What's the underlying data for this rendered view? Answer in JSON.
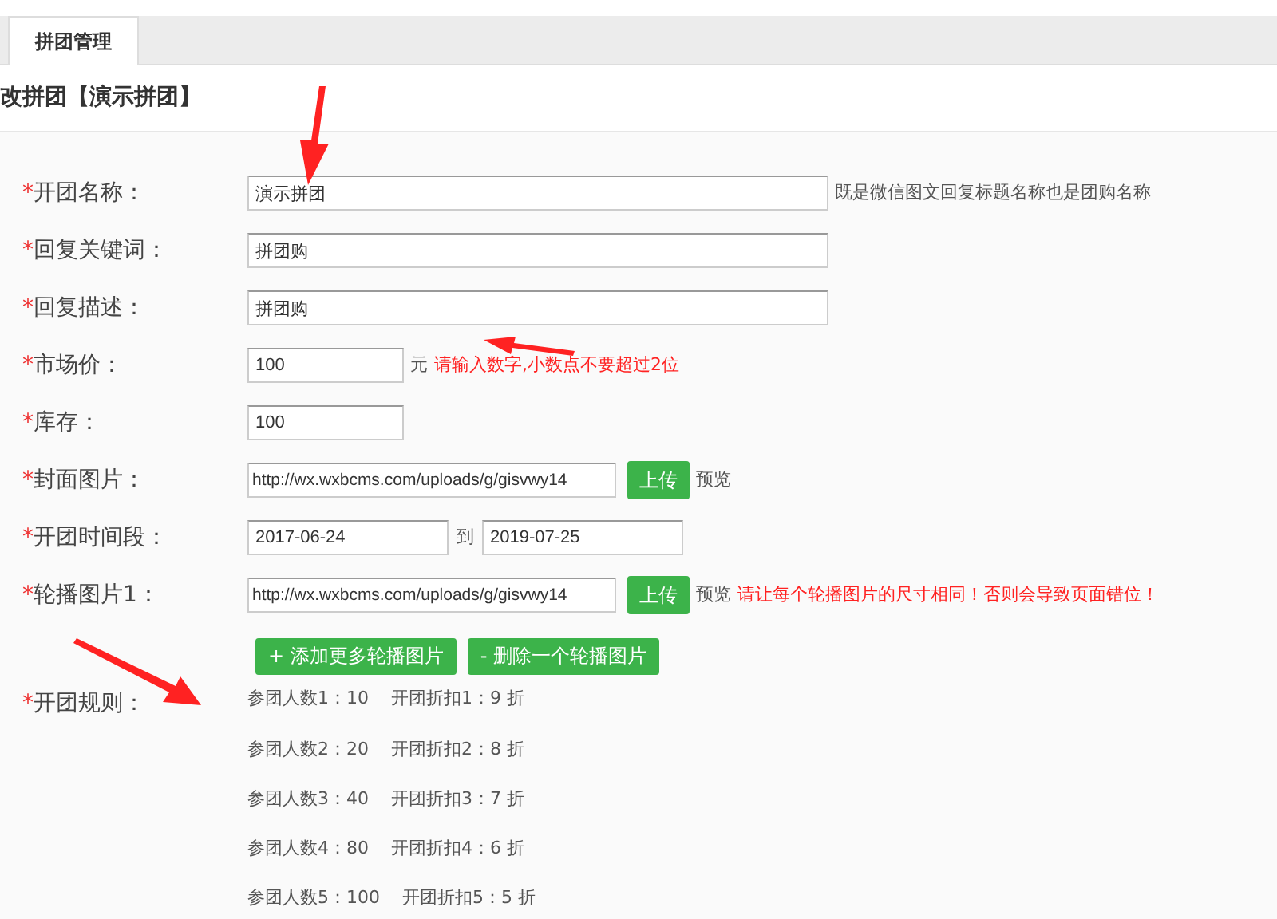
{
  "tab": {
    "label": "拼团管理",
    "selected": true
  },
  "heading": "改拼团【演示拼团】",
  "fields": [
    {
      "kind": "long",
      "mark": "*",
      "label": "开团名称：",
      "value": "演示拼团",
      "hint": "既是微信图文回复标题名称也是团购名称"
    },
    {
      "kind": "long",
      "mark": "*",
      "label": "回复关键词：",
      "value": "拼团购"
    },
    {
      "kind": "long",
      "mark": "*",
      "label": "回复描述：",
      "value": "拼团购"
    },
    {
      "kind": "short",
      "mark": "*",
      "label": "市场价：",
      "value": "100",
      "unit": "元",
      "warning": "请输入数字,小数点不要超过2位"
    },
    {
      "kind": "short",
      "mark": "*",
      "label": "库存：",
      "value": "100"
    },
    {
      "kind": "upload",
      "mark": "*",
      "label": "封面图片：",
      "value": "http://wx.wxbcms.com/uploads/g/gisvwy14",
      "button": "上传",
      "preview": "预览"
    },
    {
      "kind": "daterange",
      "mark": "*",
      "label": "开团时间段：",
      "value": "2017-06-24",
      "separator": "到",
      "value_end": "2019-07-25"
    },
    {
      "kind": "upload",
      "mark": "*",
      "label": "轮播图片1：",
      "value": "http://wx.wxbcms.com/uploads/g/gisvwy14",
      "button": "上传",
      "preview": "预览",
      "warning": "请让每个轮播图片的尺寸相同！否则会导致页面错位！"
    }
  ],
  "carousel_buttons": [
    "+ 添加更多轮播图片",
    "- 删除一个轮播图片"
  ],
  "rules": {
    "mark": "*",
    "label": "开团规则：",
    "items": [
      {
        "people": "参团人数1：10",
        "discount": "开团折扣1：9 折"
      },
      {
        "people": "参团人数2：20",
        "discount": "开团折扣2：8 折"
      },
      {
        "people": "参团人数3：40",
        "discount": "开团折扣3：7 折"
      },
      {
        "people": "参团人数4：80",
        "discount": "开团折扣4：6 折"
      },
      {
        "people": "参团人数5：100",
        "discount": "开团折扣5：5 折"
      }
    ]
  }
}
